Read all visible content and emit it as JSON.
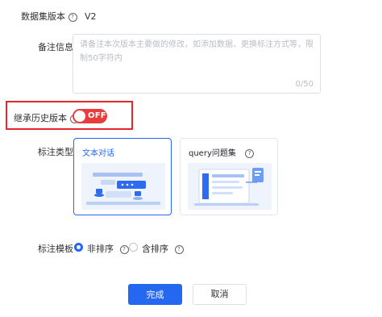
{
  "dataset_version": {
    "label": "数据集版本",
    "value": "V2"
  },
  "remark": {
    "label": "备注信息",
    "placeholder": "请备注本次版本主要做的修改，如添加数据、更换标注方式等，限制50字符内",
    "count": "0/50"
  },
  "inherit": {
    "label": "继承历史版本",
    "switch_text": "OFF",
    "enabled": false
  },
  "annotation_type": {
    "label": "标注类型",
    "options": [
      {
        "title": "文本对话",
        "selected": true
      },
      {
        "title": "query问题集",
        "selected": false
      }
    ]
  },
  "annotation_template": {
    "label": "标注模板",
    "options": [
      {
        "label": "非排序",
        "selected": true
      },
      {
        "label": "含排序",
        "selected": false
      }
    ]
  },
  "footer": {
    "confirm": "完成",
    "cancel": "取消"
  },
  "colors": {
    "primary": "#2468f2",
    "danger": "#e93d3d",
    "highlight": "#e5262f"
  }
}
